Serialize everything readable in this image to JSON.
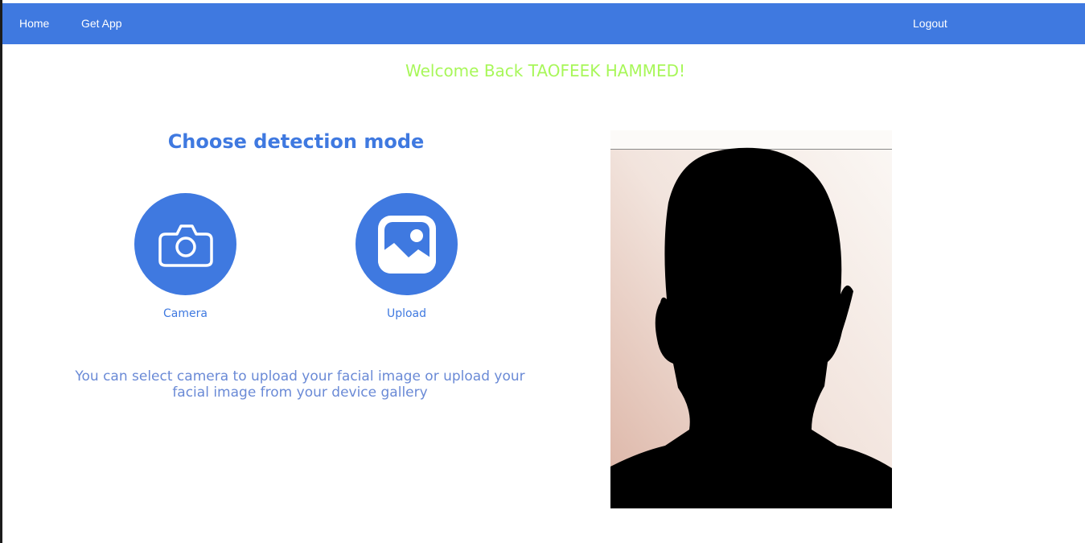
{
  "nav": {
    "home_label": "Home",
    "get_app_label": "Get App",
    "logout_label": "Logout"
  },
  "welcome_message": "Welcome Back TAOFEEK HAMMED!",
  "detection": {
    "heading": "Choose detection mode",
    "modes": [
      {
        "label": "Camera",
        "icon": "camera-icon"
      },
      {
        "label": "Upload",
        "icon": "image-icon"
      }
    ],
    "description": "You can select camera to upload your facial image or upload your facial image from your device gallery"
  },
  "colors": {
    "primary": "#3f79e0",
    "welcome": "#a8f75a",
    "description": "#6a8ad6",
    "background": "#ffffff"
  }
}
